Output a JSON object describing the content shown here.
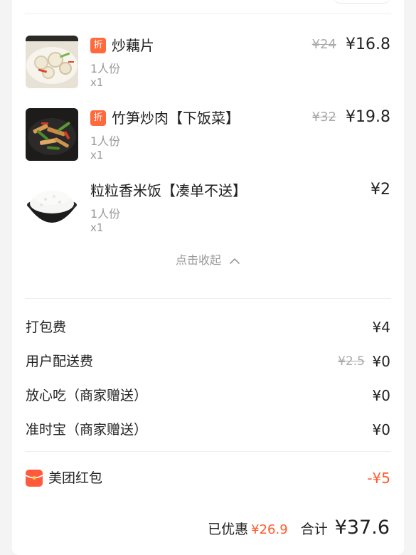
{
  "discount_tag": "折",
  "items": [
    {
      "name": "炒藕片",
      "portion": "1人份",
      "qty": "x1",
      "old_price": "¥24",
      "price": "¥16.8",
      "has_discount": true
    },
    {
      "name": "竹笋炒肉【下饭菜】",
      "portion": "1人份",
      "qty": "x1",
      "old_price": "¥32",
      "price": "¥19.8",
      "has_discount": true
    },
    {
      "name": "粒粒香米饭【凑单不送】",
      "portion": "1人份",
      "qty": "x1",
      "old_price": "",
      "price": "¥2",
      "has_discount": false
    }
  ],
  "collapse_label": "点击收起",
  "fees": [
    {
      "label": "打包费",
      "old": "",
      "value": "¥4"
    },
    {
      "label": "用户配送费",
      "old": "¥2.5",
      "value": "¥0"
    },
    {
      "label": "放心吃（商家赠送）",
      "old": "",
      "value": "¥0"
    },
    {
      "label": "准时宝（商家赠送）",
      "old": "",
      "value": "¥0"
    }
  ],
  "red_packet": {
    "label": "美团红包",
    "value": "-¥5"
  },
  "summary": {
    "discount_label": "已优惠",
    "discount_value": "¥26.9",
    "total_label": "合计",
    "total_value": "¥37.6"
  },
  "colors": {
    "accent": "#ff5a2c",
    "tag": "#ff6a3d",
    "muted": "#999999"
  },
  "icons": [
    "chevron-up-icon",
    "red-packet-icon"
  ]
}
